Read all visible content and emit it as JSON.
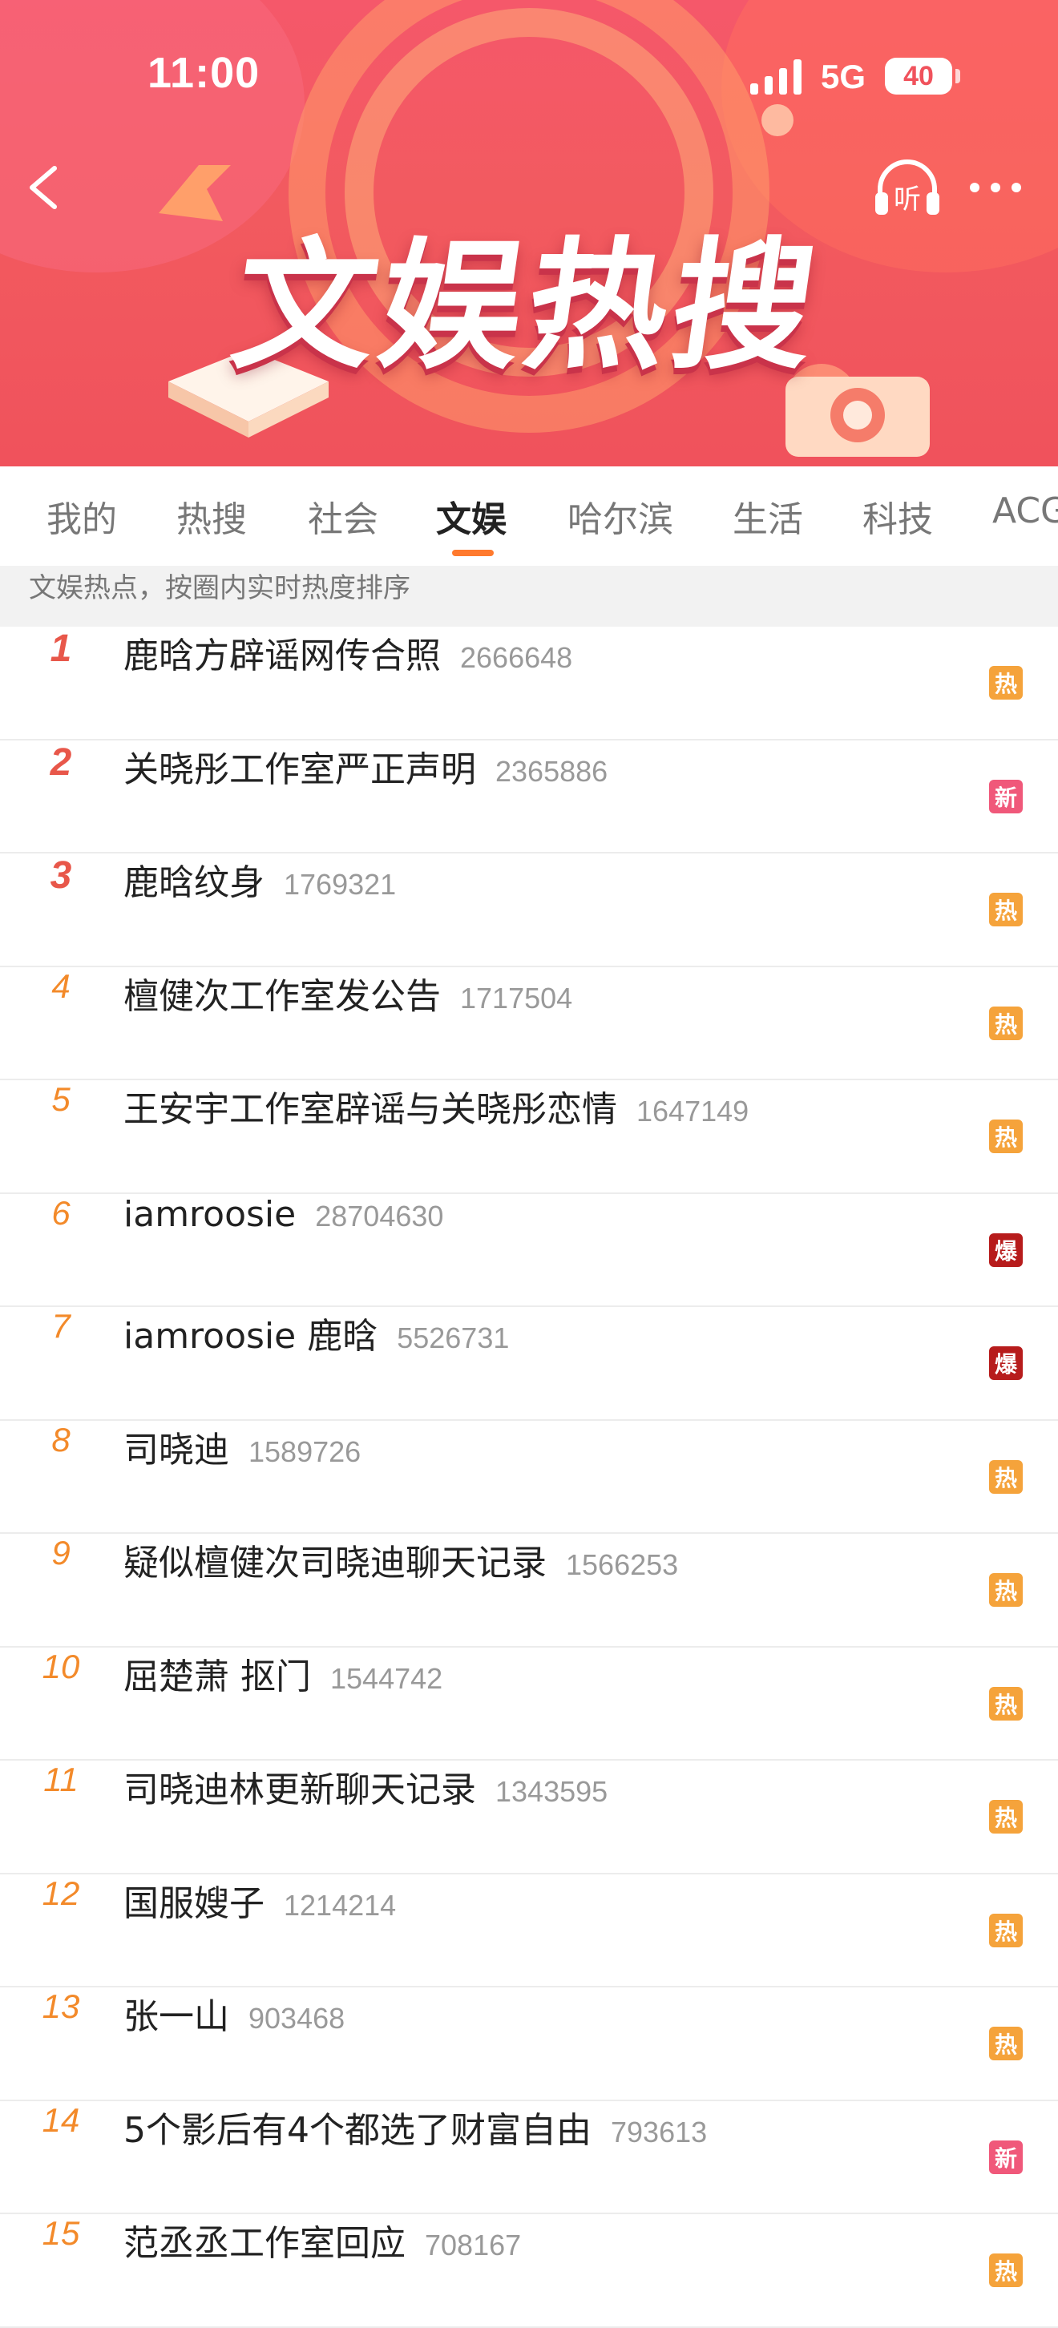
{
  "status_bar": {
    "time": "11:00",
    "network": "5G",
    "battery": "40"
  },
  "header": {
    "title": "文娱热搜",
    "listen_label": "听"
  },
  "tabs": [
    {
      "label": "我的"
    },
    {
      "label": "热搜"
    },
    {
      "label": "社会"
    },
    {
      "label": "文娱",
      "active": true
    },
    {
      "label": "哈尔滨"
    },
    {
      "label": "生活"
    },
    {
      "label": "科技"
    },
    {
      "label": "ACG"
    }
  ],
  "subheader": "文娱热点，按圈内实时热度排序",
  "badge_colors": {
    "热": "#f5a33b",
    "新": "#f0587a",
    "爆": "#b71c1c"
  },
  "items": [
    {
      "rank": "1",
      "title": "鹿晗方辟谣网传合照",
      "count": "2666648",
      "badge": "热"
    },
    {
      "rank": "2",
      "title": "关晓彤工作室严正声明",
      "count": "2365886",
      "badge": "新"
    },
    {
      "rank": "3",
      "title": "鹿晗纹身",
      "count": "1769321",
      "badge": "热"
    },
    {
      "rank": "4",
      "title": "檀健次工作室发公告",
      "count": "1717504",
      "badge": "热"
    },
    {
      "rank": "5",
      "title": "王安宇工作室辟谣与关晓彤恋情",
      "count": "1647149",
      "badge": "热"
    },
    {
      "rank": "6",
      "title": "iamroosie",
      "count": "28704630",
      "badge": "爆"
    },
    {
      "rank": "7",
      "title": "iamroosie 鹿晗",
      "count": "5526731",
      "badge": "爆"
    },
    {
      "rank": "8",
      "title": "司晓迪",
      "count": "1589726",
      "badge": "热"
    },
    {
      "rank": "9",
      "title": "疑似檀健次司晓迪聊天记录",
      "count": "1566253",
      "badge": "热"
    },
    {
      "rank": "10",
      "title": "屈楚萧 抠门",
      "count": "1544742",
      "badge": "热"
    },
    {
      "rank": "11",
      "title": "司晓迪林更新聊天记录",
      "count": "1343595",
      "badge": "热"
    },
    {
      "rank": "12",
      "title": "国服嫂子",
      "count": "1214214",
      "badge": "热"
    },
    {
      "rank": "13",
      "title": "张一山",
      "count": "903468",
      "badge": "热"
    },
    {
      "rank": "14",
      "title": "5个影后有4个都选了财富自由",
      "count": "793613",
      "badge": "新"
    },
    {
      "rank": "15",
      "title": "范丞丞工作室回应",
      "count": "708167",
      "badge": "热"
    }
  ]
}
